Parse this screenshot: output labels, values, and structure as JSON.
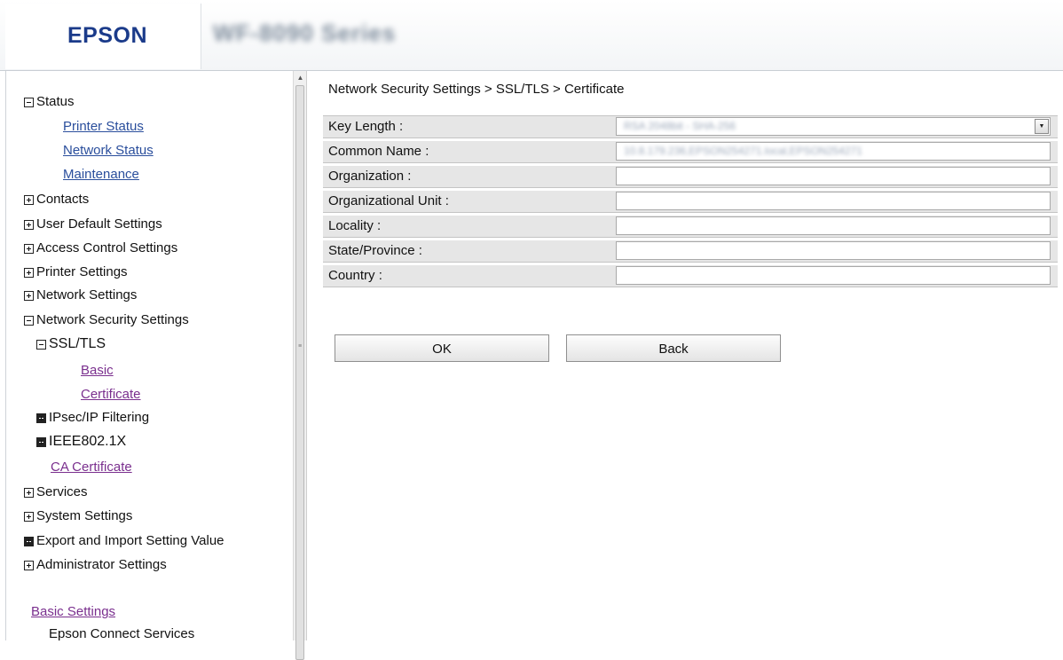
{
  "header": {
    "brand": "EPSON",
    "model": "WF-8090 Series"
  },
  "sidebar": {
    "tree": [
      {
        "label": "Status"
      },
      {
        "label": "Printer Status"
      },
      {
        "label": "Network Status"
      },
      {
        "label": "Maintenance"
      },
      {
        "label": "Contacts"
      },
      {
        "label": "User Default Settings"
      },
      {
        "label": "Access Control Settings"
      },
      {
        "label": "Printer Settings"
      },
      {
        "label": "Network Settings"
      },
      {
        "label": "Network Security Settings"
      },
      {
        "label": "SSL/TLS"
      },
      {
        "label": "Basic"
      },
      {
        "label": "Certificate"
      },
      {
        "label": "IPsec/IP Filtering"
      },
      {
        "label": "IEEE802.1X"
      },
      {
        "label": "CA Certificate"
      },
      {
        "label": "Services"
      },
      {
        "label": "System Settings"
      },
      {
        "label": "Export and Import Setting Value"
      },
      {
        "label": "Administrator Settings"
      },
      {
        "label": "Basic Settings"
      },
      {
        "label": "Epson Connect Services"
      }
    ]
  },
  "main": {
    "breadcrumb": "Network Security Settings > SSL/TLS > Certificate",
    "fields": [
      {
        "label": "Key Length :",
        "value": "RSA 2048bit - SHA-256"
      },
      {
        "label": "Common Name :",
        "value": "10.8.179.236,EPSON254271.local,EPSON254271"
      },
      {
        "label": "Organization :",
        "value": ""
      },
      {
        "label": "Organizational Unit :",
        "value": ""
      },
      {
        "label": "Locality :",
        "value": ""
      },
      {
        "label": "State/Province :",
        "value": ""
      },
      {
        "label": "Country :",
        "value": ""
      }
    ],
    "ok_label": "OK",
    "back_label": "Back"
  }
}
